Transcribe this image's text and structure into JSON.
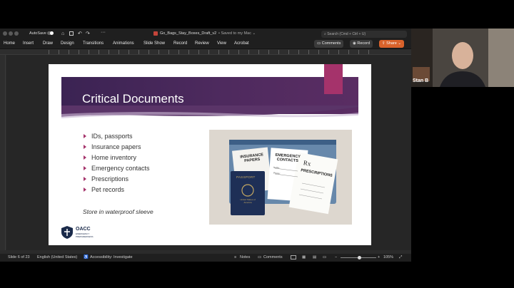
{
  "titlebar": {
    "autosave_label": "AutoSave",
    "doc_title": "Go_Bags_Stay_Boxes_Draft_v2",
    "saved_status": "• Saved to my Mac ⌄",
    "search_placeholder": "Search (Cmd + Ctrl + U)"
  },
  "ribbon": {
    "tabs": [
      "Home",
      "Insert",
      "Draw",
      "Design",
      "Transitions",
      "Animations",
      "Slide Show",
      "Record",
      "Review",
      "View",
      "Acrobat"
    ],
    "comments_label": "Comments",
    "record_label": "Record",
    "share_label": "Share"
  },
  "slide": {
    "title": "Critical Documents",
    "bullets": [
      "IDs, passports",
      "Insurance papers",
      "Home inventory",
      "Emergency contacts",
      "Prescriptions",
      "Pet records"
    ],
    "note": "Store in waterproof sleeve",
    "logo_text": "OACC",
    "logo_sub": "EMERGENCY PREPAREDNESS",
    "photo": {
      "passport_label": "PASSPORT",
      "passport_sub": "United States of America",
      "card1": "INSURANCE PAPERS",
      "card2": "EMERGENCY CONTACTS",
      "card2_fields": [
        "Name:",
        "Phone:"
      ],
      "card3_symbol": "Rx",
      "card3": "PRESCRIPTIONS"
    }
  },
  "statusbar": {
    "slide_info": "Slide 6 of 23",
    "language": "English (United States)",
    "accessibility": "Accessibility: Investigate",
    "notes": "Notes",
    "comments": "Comments",
    "zoom": "105%"
  },
  "webcam": {
    "name": "Stan B"
  },
  "colors": {
    "banner": "#4e2a5e",
    "accent": "#a5336b",
    "share_button": "#d9622b"
  }
}
